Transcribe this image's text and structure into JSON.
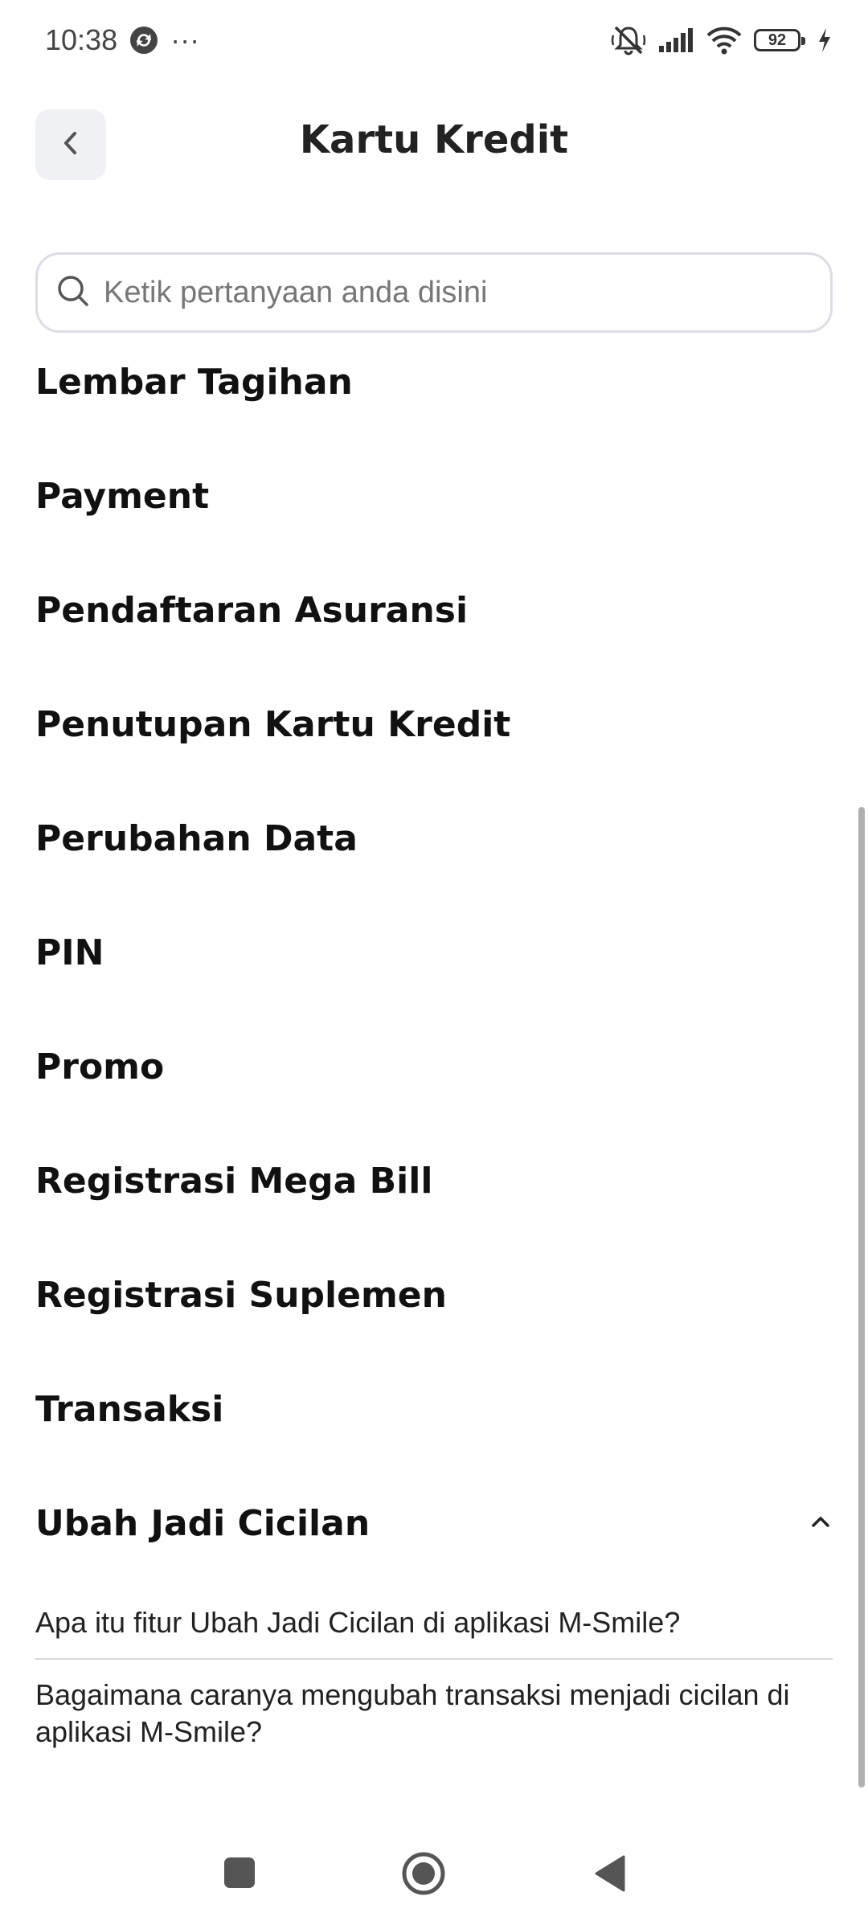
{
  "status_bar": {
    "time": "10:38",
    "more_indicator": "···",
    "battery_level": "92",
    "icons": [
      "sync-icon",
      "silent-icon",
      "signal-icon",
      "wifi-icon",
      "battery-icon",
      "charging-icon"
    ]
  },
  "header": {
    "title": "Kartu Kredit",
    "back_icon": "chevron-left-icon"
  },
  "search": {
    "placeholder": "Ketik pertanyaan anda disini",
    "value": "",
    "icon": "search-icon"
  },
  "categories": [
    {
      "label": "Lembar Tagihan"
    },
    {
      "label": "Payment"
    },
    {
      "label": "Pendaftaran Asuransi"
    },
    {
      "label": "Penutupan Kartu Kredit"
    },
    {
      "label": "Perubahan Data"
    },
    {
      "label": "PIN"
    },
    {
      "label": "Promo"
    },
    {
      "label": "Registrasi Mega Bill"
    },
    {
      "label": "Registrasi Suplemen"
    },
    {
      "label": "Transaksi"
    },
    {
      "label": "Ubah Jadi Cicilan",
      "expanded": true,
      "toggle_icon": "chevron-up-icon"
    }
  ],
  "expanded_questions": [
    "Apa itu fitur Ubah Jadi Cicilan di aplikasi M-Smile?",
    "Bagaimana caranya mengubah transaksi menjadi cicilan di aplikasi M-Smile?"
  ],
  "nav_bar": {
    "icons": [
      "recents-square-icon",
      "home-circle-icon",
      "back-triangle-icon"
    ]
  }
}
